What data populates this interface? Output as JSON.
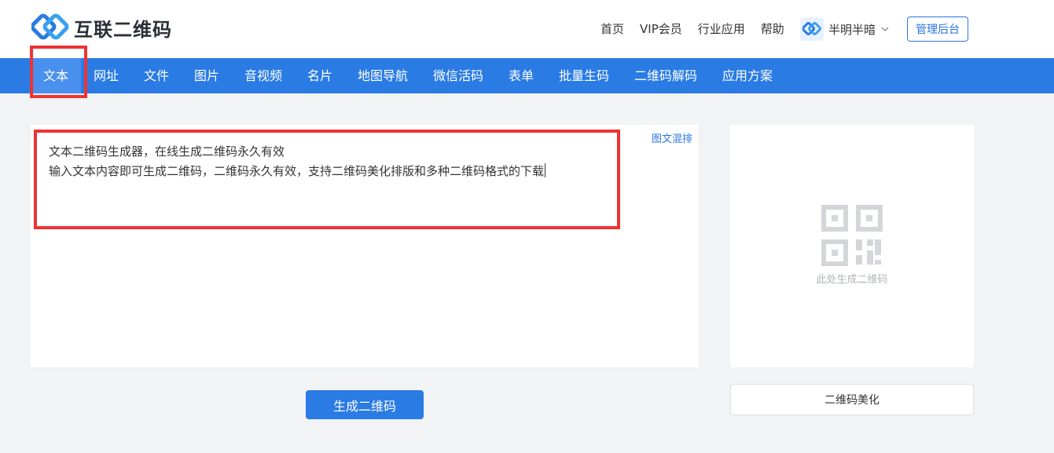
{
  "brand": {
    "name": "互联二维码"
  },
  "top_links": [
    "首页",
    "VIP会员",
    "行业应用",
    "帮助"
  ],
  "user": {
    "name": "半明半暗"
  },
  "admin_button": "管理后台",
  "nav": {
    "items": [
      "文本",
      "网址",
      "文件",
      "图片",
      "音视频",
      "名片",
      "地图导航",
      "微信活码",
      "表单",
      "批量生码",
      "二维码解码",
      "应用方案"
    ],
    "active": "文本"
  },
  "editor": {
    "mix_link": "图文混排",
    "line1": "文本二维码生成器，在线生成二维码永久有效",
    "line2": "输入文本内容即可生成二维码，二维码永久有效，支持二维码美化排版和多种二维码格式的下载"
  },
  "generate_button": "生成二维码",
  "preview": {
    "hint": "此处生成二维码"
  },
  "beautify_button": "二维码美化",
  "colors": {
    "primary": "#2a7be4",
    "highlight": "#ee3333",
    "background": "#f2f3f5"
  }
}
